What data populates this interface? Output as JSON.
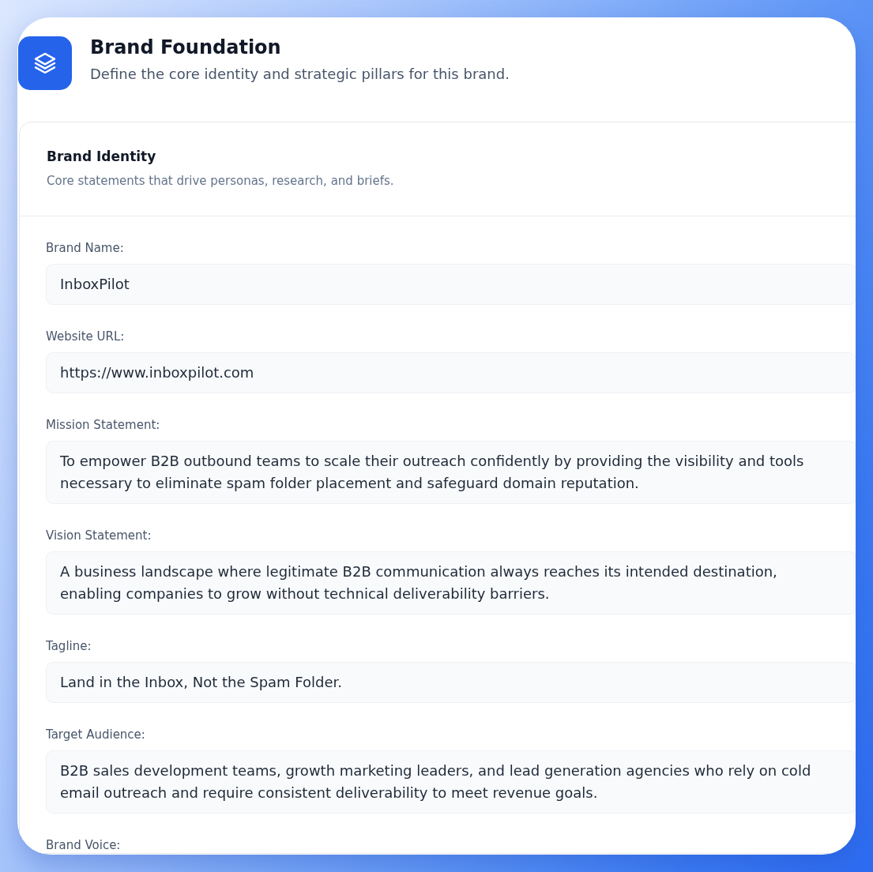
{
  "header": {
    "title": "Brand Foundation",
    "subtitle": "Define the core identity and strategic pillars for this brand."
  },
  "section": {
    "title": "Brand Identity",
    "description": "Core statements that drive personas, research, and briefs.",
    "fields": [
      {
        "label": "Brand Name:",
        "value": "InboxPilot"
      },
      {
        "label": "Website URL:",
        "value": "https://www.inboxpilot.com"
      },
      {
        "label": "Mission Statement:",
        "value": "To empower B2B outbound teams to scale their outreach confidently by providing the visibility and tools necessary to eliminate spam folder placement and safeguard domain reputation."
      },
      {
        "label": "Vision Statement:",
        "value": "A business landscape where legitimate B2B communication always reaches its intended destination, enabling companies to grow without technical deliverability barriers."
      },
      {
        "label": "Tagline:",
        "value": "Land in the Inbox, Not the Spam Folder."
      },
      {
        "label": "Target Audience:",
        "value": "B2B sales development teams, growth marketing leaders, and lead generation agencies who rely on cold email outreach and require consistent deliverability to meet revenue goals."
      },
      {
        "label": "Brand Voice:"
      }
    ]
  }
}
